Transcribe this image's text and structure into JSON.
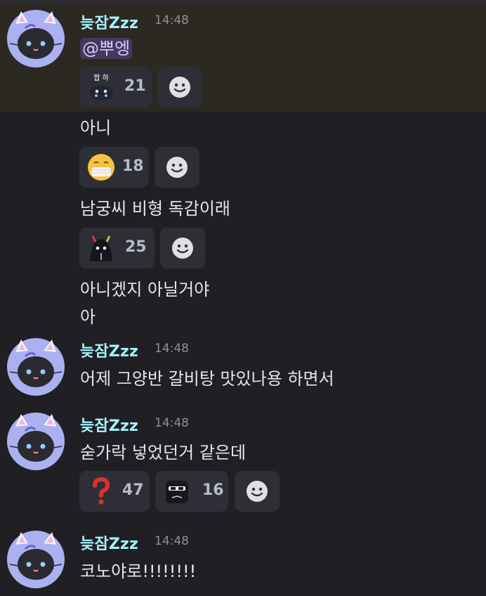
{
  "user": {
    "name": "늦잠Zzz",
    "name_color": "#a6f1ff"
  },
  "blocks": [
    {
      "time": "14:48",
      "mention": "@뿌엥"
    },
    {
      "time": "14:48",
      "text": "어제 그양반 갈비탕 맛있나용 하면서"
    },
    {
      "time": "14:48",
      "text": "숟가락 넣었던거 같은데"
    },
    {
      "time": "14:48",
      "text": "코노야로!!!!!!!!"
    }
  ],
  "lines": [
    {
      "text": "아니"
    },
    {
      "text": "남궁씨 비형 독감이래"
    },
    {
      "text": "아니겠지 아닐거야"
    },
    {
      "text": "아"
    }
  ],
  "reactions": [
    {
      "icon": "jjapha-sticker-icon",
      "count": "21"
    },
    {
      "icon": "mask-face-icon",
      "count": "18"
    },
    {
      "icon": "black-blob-sticker-icon",
      "count": "25"
    },
    {
      "icon": "red-question-icon",
      "count": "47"
    },
    {
      "icon": "sunglasses-face-icon",
      "count": "16"
    }
  ],
  "emoji_text": {
    "jjapha": "짭 하"
  },
  "colors": {
    "background": "#1f1f24",
    "highlight": "#2c2822",
    "reaction_bg": "#2e2f36"
  }
}
